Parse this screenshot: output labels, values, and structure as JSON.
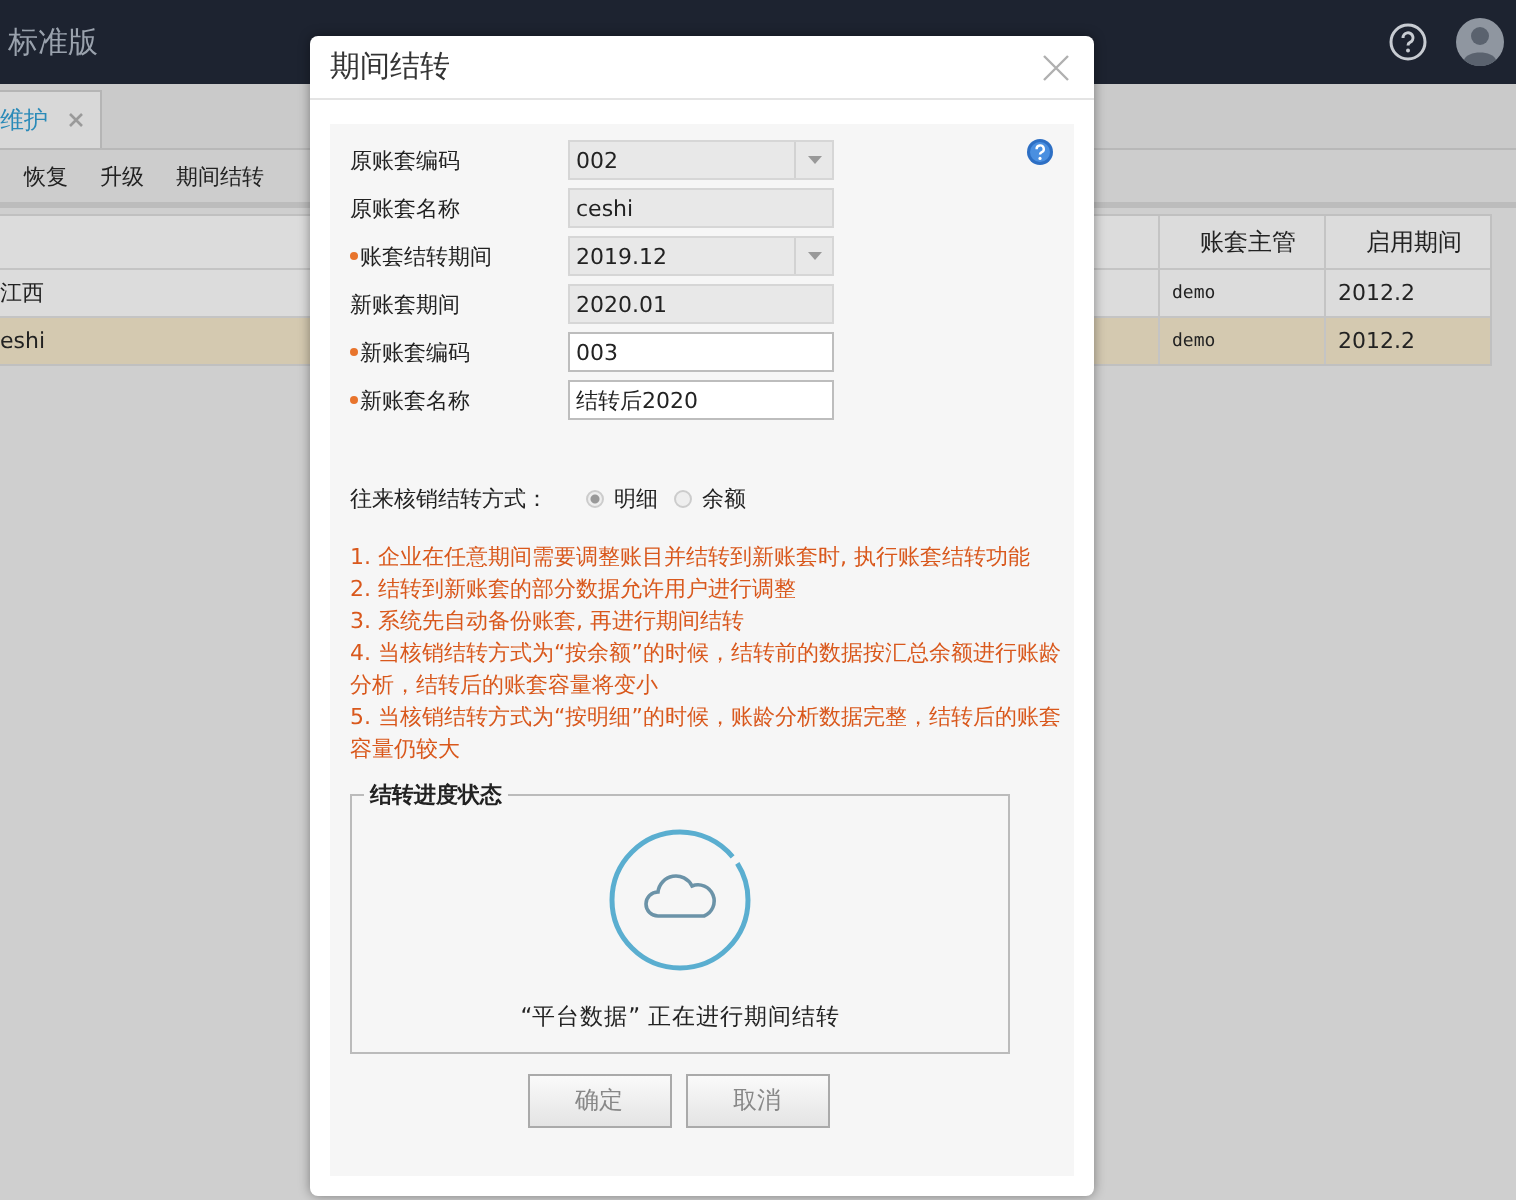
{
  "app": {
    "title": "标准版"
  },
  "tabs": [
    {
      "label": "维护",
      "selected": true
    }
  ],
  "toolbar": [
    "恢复",
    "升级",
    "期间结转"
  ],
  "table": {
    "columns": [
      "账套主管",
      "启用期间"
    ],
    "rows": [
      {
        "column_1": "江西",
        "manager": "demo",
        "start": "2012.2",
        "selected": false
      },
      {
        "column_1": "eshi",
        "manager": "demo",
        "start": "2012.2",
        "selected": true
      }
    ]
  },
  "dialog": {
    "title": "期间结转",
    "fields": [
      {
        "label": "原账套编码",
        "value": "002",
        "kind": "select",
        "required": false,
        "disabled": true
      },
      {
        "label": "原账套名称",
        "value": "ceshi",
        "kind": "text",
        "required": false,
        "disabled": true
      },
      {
        "label": "账套结转期间",
        "value": "2019.12",
        "kind": "select",
        "required": true,
        "disabled": true
      },
      {
        "label": "新账套期间",
        "value": "2020.01",
        "kind": "text",
        "required": false,
        "disabled": true
      },
      {
        "label": "新账套编码",
        "value": "003",
        "kind": "text",
        "required": true,
        "disabled": false
      },
      {
        "label": "新账套名称",
        "value": "结转后2020",
        "kind": "text",
        "required": true,
        "disabled": false
      }
    ],
    "mode": {
      "label": "往来核销结转方式：",
      "options": [
        {
          "label": "明细",
          "selected": true
        },
        {
          "label": "余额",
          "selected": false
        }
      ]
    },
    "notes": [
      "1. 企业在任意期间需要调整账目并结转到新账套时, 执行账套结转功能",
      "2. 结转到新账套的部分数据允许用户进行调整",
      "3. 系统先自动备份账套, 再进行期间结转",
      "4. 当核销结转方式为“按余额”的时候，结转前的数据按汇总余额进行账龄分析，结转后的账套容量将变小",
      "5. 当核销结转方式为“按明细”的时候，账龄分析数据完整，结转后的账套容量仍较大"
    ],
    "progress": {
      "legend": "结转进度状态",
      "message": "“平台数据” 正在进行期间结转"
    },
    "buttons": [
      "确定",
      "取消"
    ]
  }
}
